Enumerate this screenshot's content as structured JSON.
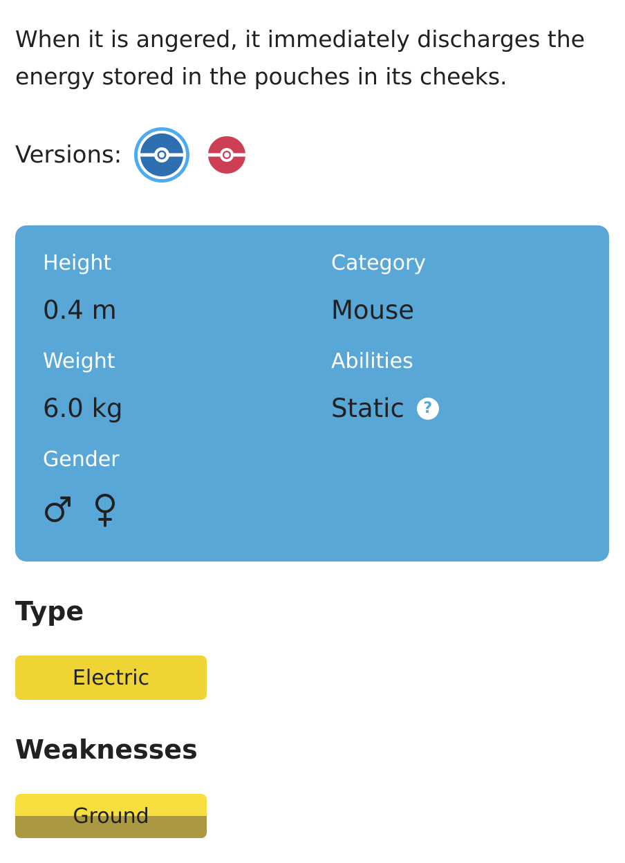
{
  "flavor_text": "When it is angered, it immediately discharges the energy stored in the pouches in its cheeks.",
  "versions": {
    "label": "Versions:",
    "items": [
      {
        "icon": "pokeball-blue-version-icon",
        "color": "#30a7d7",
        "selected": true
      },
      {
        "icon": "pokeball-red-version-icon",
        "color": "#cc3f55",
        "selected": false
      }
    ]
  },
  "info_card": {
    "background": "#58a7d7",
    "height": {
      "label": "Height",
      "value": "0.4 m"
    },
    "weight": {
      "label": "Weight",
      "value": "6.0 kg"
    },
    "gender": {
      "label": "Gender",
      "icons": [
        "male-icon",
        "female-icon"
      ]
    },
    "category": {
      "label": "Category",
      "value": "Mouse"
    },
    "abilities": {
      "label": "Abilities",
      "value": "Static",
      "help_icon": "question-icon",
      "help_glyph": "?"
    }
  },
  "type_section": {
    "heading": "Type",
    "types": [
      {
        "label": "Electric",
        "color": "#eed535"
      }
    ]
  },
  "weaknesses_section": {
    "heading": "Weaknesses",
    "types": [
      {
        "label": "Ground",
        "color_top": "#f7de3f",
        "color_bottom": "#ab9842"
      }
    ]
  }
}
